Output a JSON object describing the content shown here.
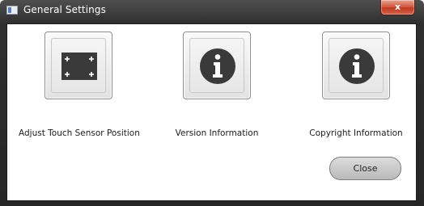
{
  "window": {
    "title": "General Settings",
    "close_glyph": "x",
    "app_icon": "window-icon"
  },
  "tiles": [
    {
      "label": "Adjust Touch Sensor Position",
      "icon": "touch-sensor-icon"
    },
    {
      "label": "Version Information",
      "icon": "info-icon"
    },
    {
      "label": "Copyright Information",
      "icon": "info-icon"
    }
  ],
  "buttons": {
    "close_label": "Close"
  },
  "colors": {
    "titlebar": "#2e2e2e",
    "close_x": "#c1391f",
    "tile_icon": "#3a3a3a"
  }
}
